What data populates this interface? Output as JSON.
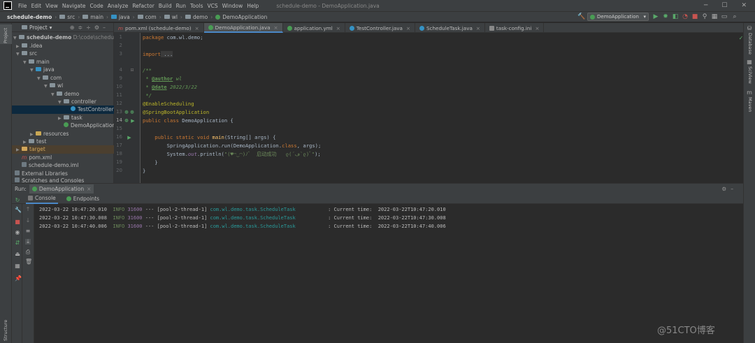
{
  "menubar": {
    "items": [
      "File",
      "Edit",
      "View",
      "Navigate",
      "Code",
      "Analyze",
      "Refactor",
      "Build",
      "Run",
      "Tools",
      "VCS",
      "Window",
      "Help"
    ],
    "title": "schedule-demo - DemoApplication.java"
  },
  "breadcrumb": [
    "schedule-demo",
    "src",
    "main",
    "java",
    "com",
    "wl",
    "demo",
    "DemoApplication"
  ],
  "run_config": "DemoApplication",
  "side": {
    "project": "Project",
    "structure": "Structure",
    "database": "Database",
    "sciview": "SciView",
    "maven": "Maven"
  },
  "project_panel": {
    "header": "Project",
    "tree": [
      {
        "label": "schedule-demo",
        "extra": "D:\\code\\schedule-de"
      },
      {
        "label": ".idea"
      },
      {
        "label": "src"
      },
      {
        "label": "main"
      },
      {
        "label": "java"
      },
      {
        "label": "com"
      },
      {
        "label": "wl"
      },
      {
        "label": "demo"
      },
      {
        "label": "controller"
      },
      {
        "label": "TestController"
      },
      {
        "label": "task"
      },
      {
        "label": "DemoApplication"
      },
      {
        "label": "resources"
      },
      {
        "label": "test"
      },
      {
        "label": "target"
      },
      {
        "label": "pom.xml"
      },
      {
        "label": "schedule-demo.iml"
      },
      {
        "label": "External Libraries"
      },
      {
        "label": "Scratches and Consoles"
      }
    ]
  },
  "tabs": [
    {
      "label": "pom.xml (schedule-demo)"
    },
    {
      "label": "DemoApplication.java"
    },
    {
      "label": "application.yml"
    },
    {
      "label": "TestController.java"
    },
    {
      "label": "ScheduleTask.java"
    },
    {
      "label": "task-config.ini"
    }
  ],
  "line_numbers": [
    "1",
    "2",
    "3",
    "4",
    "9",
    "10",
    "11",
    "12",
    "13",
    "14",
    "15",
    "16",
    "17",
    "18",
    "19",
    "20"
  ],
  "code": {
    "l1_kw": "package",
    "l1_rest": " com.wl.demo;",
    "l3_kw": "import",
    "l3_rest": " ...",
    "l5": "/**",
    "l6_a": " * ",
    "l6_tag": "@author",
    "l6_b": " wl",
    "l7_a": " * ",
    "l7_tag": "@date",
    "l7_b": " 2022/3/22",
    "l8": " */",
    "l9": "@EnableScheduling",
    "l10": "@SpringBootApplication",
    "l11_kw": "public class",
    "l11_rest": " DemoApplication {",
    "l13_kw": "    public static void ",
    "l13_fn": "main",
    "l13_rest": "(String[] args) {",
    "l14_a": "        SpringApplication.",
    "l14_it": "run",
    "l14_b": "(DemoApplication.",
    "l14_kw": "class",
    "l14_c": ", args);",
    "l15_a": "        System.",
    "l15_fld": "out",
    "l15_b": ".println(",
    "l15_str": "\"(♥◠‿◠)ﾉﾞ  启动成功   ლ(´ڡ`ლ)ﾞ\"",
    "l15_c": ");",
    "l16": "    }",
    "l17": "}"
  },
  "run": {
    "label": "Run:",
    "config": "DemoApplication",
    "console_tab": "Console",
    "endpoints_tab": "Endpoints"
  },
  "logs": [
    {
      "ts": "2022-03-22 10:47:20.010",
      "lvl": "INFO",
      "pid": "31600",
      "sep": "---",
      "thread": "[pool-2-thread-1]",
      "cls": "com.wl.demo.task.ScheduleTask",
      "msg": ": Current time:  2022-03-22T10:47:20.010"
    },
    {
      "ts": "2022-03-22 10:47:30.008",
      "lvl": "INFO",
      "pid": "31600",
      "sep": "---",
      "thread": "[pool-2-thread-1]",
      "cls": "com.wl.demo.task.ScheduleTask",
      "msg": ": Current time:  2022-03-22T10:47:30.008"
    },
    {
      "ts": "2022-03-22 10:47:40.006",
      "lvl": "INFO",
      "pid": "31600",
      "sep": "---",
      "thread": "[pool-2-thread-1]",
      "cls": "com.wl.demo.task.ScheduleTask",
      "msg": ": Current time:  2022-03-22T10:47:40.006"
    }
  ],
  "watermark": "@51CTO博客",
  "colors": {
    "accent": "#4a88c7",
    "bg": "#2b2b2b",
    "panel": "#3c3f41",
    "selection": "#0d293e"
  }
}
